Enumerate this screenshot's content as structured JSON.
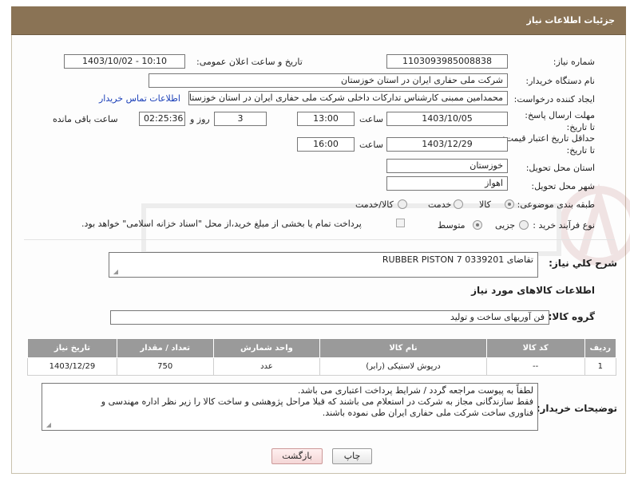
{
  "header": {
    "title": "جزئیات اطلاعات نیاز"
  },
  "fields": {
    "need_number_label": "شماره نیاز:",
    "need_number": "1103093985008838",
    "announce_label": "تاریخ و ساعت اعلان عمومی:",
    "announce_value": "1403/10/02 - 10:10",
    "buyer_label": "نام دستگاه خریدار:",
    "buyer_value": "شرکت ملی حفاری ایران در استان خوزستان",
    "creator_label": "ایجاد کننده درخواست:",
    "creator_value": "محمدامین ممبنی کارشناس تدارکات داخلی شرکت ملی حفاری ایران در استان خوزستان",
    "contact_link": "اطلاعات تماس خریدار",
    "reply_deadline_label": "مهلت ارسال پاسخ: تا تاریخ:",
    "reply_date": "1403/10/05",
    "time_label": "ساعت",
    "reply_time": "13:00",
    "days_value": "3",
    "days_label": "روز و",
    "remaining_time": "02:25:36",
    "remaining_label": "ساعت باقی مانده",
    "price_validity_label": "حداقل تاریخ اعتبار قیمت: تا تاریخ:",
    "price_date": "1403/12/29",
    "price_time": "16:00",
    "province_label": "استان محل تحویل:",
    "province_value": "خوزستان",
    "city_label": "شهر محل تحویل:",
    "city_value": "اهواز",
    "category_label": "طبقه بندی موضوعی:",
    "category_options": [
      "کالا",
      "خدمت",
      "کالا/خدمت"
    ],
    "process_label": "نوع فرآیند خرید :",
    "process_options": [
      "جزیی",
      "متوسط"
    ],
    "payment_note": "پرداخت تمام یا بخشی از مبلغ خرید،از محل \"اسناد خزانه اسلامی\" خواهد بود.",
    "summary_label": "شرح کلي نياز:",
    "summary_value": "تقاضای RUBBER PISTON 7 0339201",
    "goods_info_title": "اطلاعات کالاهای مورد نیاز",
    "goods_group_label": "گروه کالا:",
    "goods_group_value": "فن آوریهای ساخت و تولید"
  },
  "table": {
    "headers": [
      "ردیف",
      "کد کالا",
      "نام کالا",
      "واحد شمارش",
      "تعداد / مقدار",
      "تاریخ نیاز"
    ],
    "rows": [
      [
        "1",
        "--",
        "درپوش لاستیکی (رابر)",
        "عدد",
        "750",
        "1403/12/29"
      ]
    ]
  },
  "buyer_notes": {
    "label": "توضیحات خریدار:",
    "line1": "لطفاً به پیوست مراجعه گردد / شرایط پرداخت اعتباری می باشد.",
    "line2": "فقط سازندگانی مجاز به شرکت در استعلام می باشند که قبلا مراحل پژوهشی و ساخت کالا را زیر نظر اداره مهندسی و",
    "line3": "فناوری ساخت شرکت ملی حفاری ایران طی نموده باشند."
  },
  "buttons": {
    "print": "چاپ",
    "back": "بازگشت"
  },
  "colors": {
    "header": "#8a7355",
    "table_header": "#9a9a9a",
    "link": "#1a3fb8"
  }
}
